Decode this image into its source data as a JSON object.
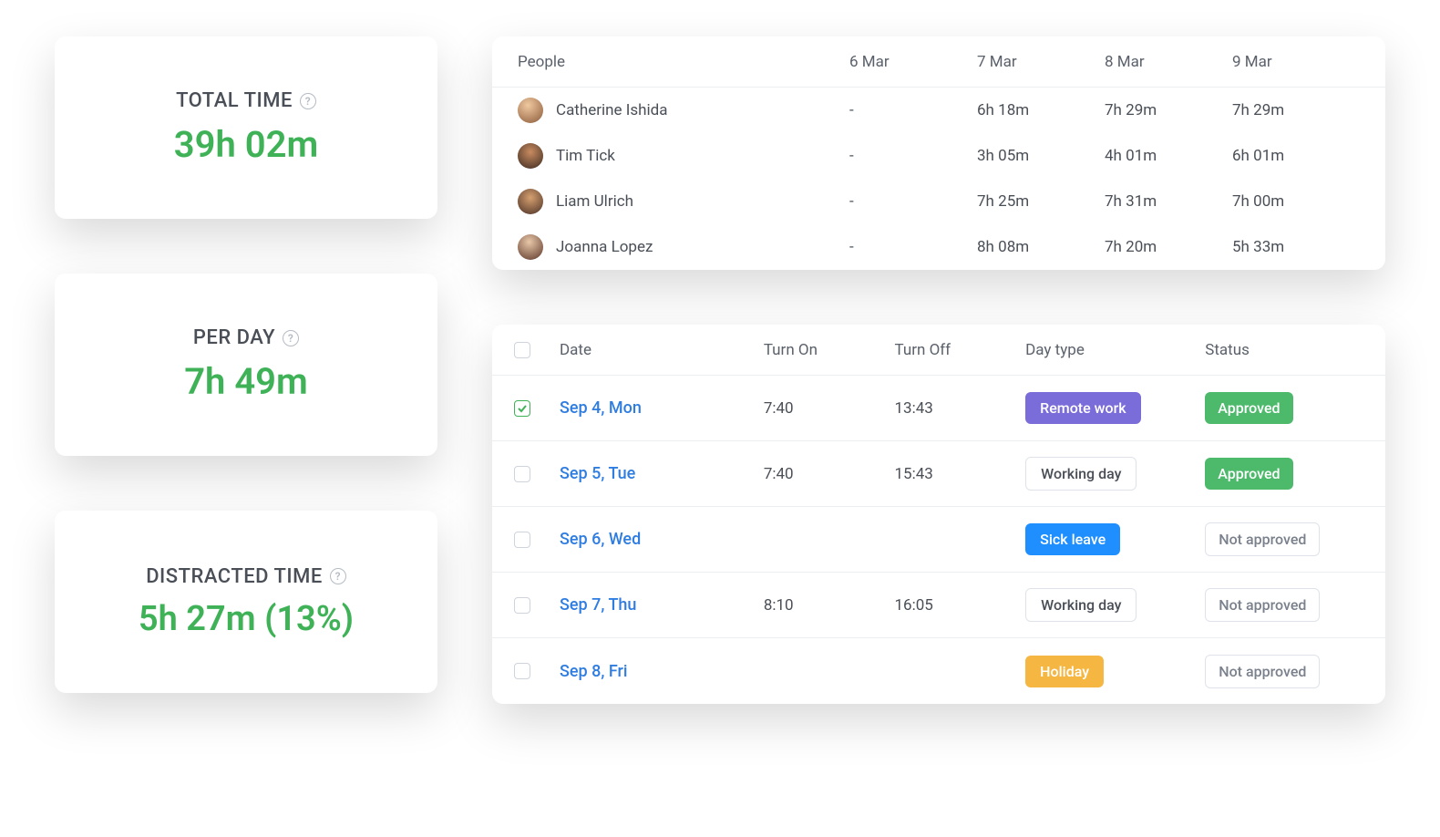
{
  "stats": {
    "total_time": {
      "label": "TOTAL TIME",
      "value": "39h 02m"
    },
    "per_day": {
      "label": "PER DAY",
      "value": "7h 49m"
    },
    "distracted": {
      "label": "DISTRACTED TIME",
      "value": "5h 27m (13%)"
    }
  },
  "people_table": {
    "header_label": "People",
    "dates": [
      "6 Mar",
      "7 Mar",
      "8 Mar",
      "9 Mar"
    ],
    "rows": [
      {
        "name": "Catherine Ishida",
        "times": [
          "-",
          "6h 18m",
          "7h 29m",
          "7h 29m"
        ]
      },
      {
        "name": "Tim Tick",
        "times": [
          "-",
          "3h 05m",
          "4h 01m",
          "6h 01m"
        ]
      },
      {
        "name": "Liam Ulrich",
        "times": [
          "-",
          "7h 25m",
          "7h 31m",
          "7h 00m"
        ]
      },
      {
        "name": "Joanna Lopez",
        "times": [
          "-",
          "8h 08m",
          "7h 20m",
          "5h 33m"
        ]
      }
    ]
  },
  "timesheet": {
    "columns": {
      "date": "Date",
      "on": "Turn On",
      "off": "Turn Off",
      "type": "Day type",
      "status": "Status"
    },
    "rows": [
      {
        "checked": true,
        "date": "Sep 4, Mon",
        "on": "7:40",
        "off": "13:43",
        "type": "Remote work",
        "type_style": "purple",
        "status": "Approved",
        "status_style": "approved"
      },
      {
        "checked": false,
        "date": "Sep 5, Tue",
        "on": "7:40",
        "off": "15:43",
        "type": "Working day",
        "type_style": "outline",
        "status": "Approved",
        "status_style": "approved"
      },
      {
        "checked": false,
        "date": "Sep 6, Wed",
        "on": "",
        "off": "",
        "type": "Sick leave",
        "type_style": "blue",
        "status": "Not approved",
        "status_style": "not"
      },
      {
        "checked": false,
        "date": "Sep 7, Thu",
        "on": "8:10",
        "off": "16:05",
        "type": "Working day",
        "type_style": "outline",
        "status": "Not approved",
        "status_style": "not"
      },
      {
        "checked": false,
        "date": "Sep 8, Fri",
        "on": "",
        "off": "",
        "type": "Holiday",
        "type_style": "orange",
        "status": "Not approved",
        "status_style": "not"
      }
    ]
  },
  "colors": {
    "green": "#3fb257",
    "purple": "#7a6cd9",
    "blue": "#1f8fff",
    "orange": "#f5b642",
    "badge_green": "#4cb96b"
  }
}
